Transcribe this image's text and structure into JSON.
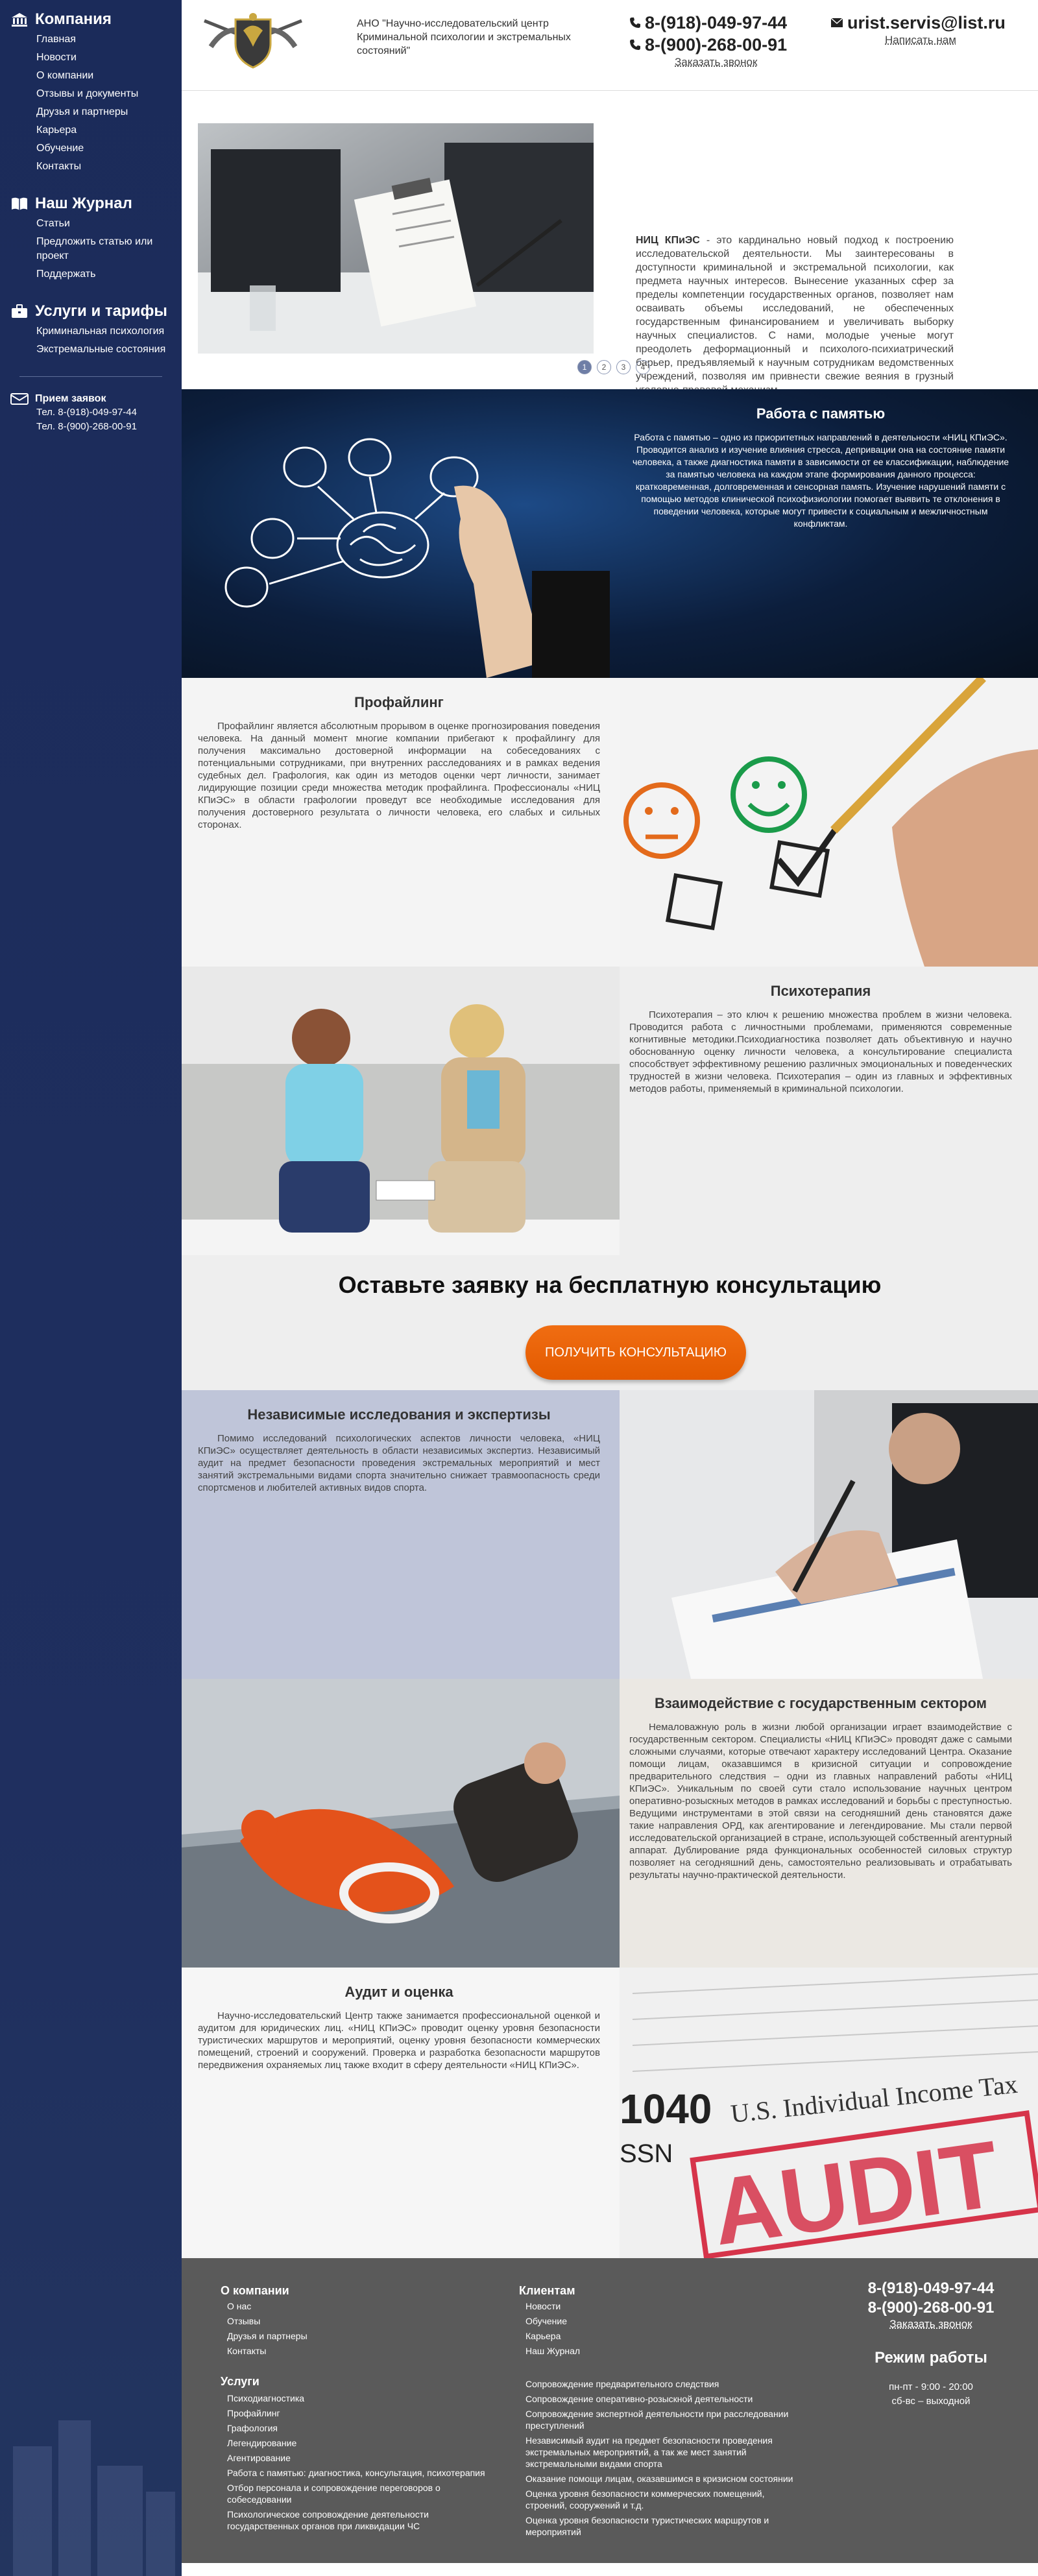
{
  "sidebar": {
    "company": {
      "title": "Компания",
      "items": [
        "Главная",
        "Новости",
        "О компании",
        "Отзывы и документы",
        "Друзья и партнеры",
        "Карьера",
        "Обучение",
        "Контакты"
      ]
    },
    "journal": {
      "title": "Наш Журнал",
      "items": [
        "Статьи",
        "Предложить статью или проект",
        "Поддержать"
      ]
    },
    "services": {
      "title": "Услуги и тарифы",
      "items": [
        "Криминальная психология",
        "Экстремальные состояния"
      ]
    },
    "contact": {
      "title": "Прием заявок",
      "phone1": "Тел. 8-(918)-049-97-44",
      "phone2": "Тел. 8-(900)-268-00-91"
    }
  },
  "header": {
    "company_name": "АНО \"Научно-исследовательский центр Криминальной психологии и экстремальных состояний\"",
    "phone1": "8-(918)-049-97-44",
    "phone2": "8-(900)-268-00-91",
    "callback_link": "Заказать звонок",
    "email": "urist.servis@list.ru",
    "write_link": "Написать нам"
  },
  "slider": {
    "lead": "НИЦ КПиЭС",
    "text": " - это кардинально новый подход к построению исследовательской деятельности. Мы заинтересованы в доступности криминальной и экстремальной психологии, как предмета научных интересов. Вынесение указанных сфер за пределы компетенции государственных органов, позволяет нам осваивать объемы исследований, не обеспеченных государственным финансированием и увеличивать выборку научных специалистов. С нами, молодые ученые могут преодолеть деформационный и психолого-психиатрический барьер, предъявляемый к научным сотрудникам ведомственных учреждений, позволяя им привнести свежие веяния в грузный уголовно-правовой механизм.",
    "dots": [
      "1",
      "2",
      "3",
      "4"
    ],
    "active_dot": 0
  },
  "memory": {
    "title": "Работа с памятью",
    "text": "Работа с памятью – одно из приоритетных направлений в деятельности «НИЦ КПиЭС». Проводится анализ и изучение влияния стресса, депривации она на состояние памяти человека, а также диагностика памяти в зависимости от ее классификации, наблюдение за памятью человека на каждом этапе формирования данного процесса: кратковременная, долговременная и сенсорная память. Изучение нарушений памяти с помощью методов клинической психофизиологии помогает выявить те отклонения в поведении человека, которые могут привести к социальным и межличностным конфликтам."
  },
  "profiling": {
    "title": "Профайлинг",
    "text": "Профайлинг является абсолютным прорывом в оценке прогнозирования поведения человека. На данный момент многие компании прибегают к профайлингу для получения максимально достоверной информации на собеседованиях с потенциальными сотрудниками, при внутренних расследованиях и в рамках ведения судебных дел. Графология, как один из методов оценки черт личности, занимает лидирующие позиции среди множества методик профайлинга. Профессионалы «НИЦ КПиЭС» в области графологии проведут все необходимые исследования для получения достоверного результата о личности человека, его слабых и сильных сторонах."
  },
  "therapy": {
    "title": "Психотерапия",
    "text": "Психотерапия – это ключ к решению множества проблем в жизни человека. Проводится работа с личностными проблемами, применяются современные когнитивные методики.Психодиагностика позволяет дать объективную и научно обоснованную оценку личности человека, а консультирование специалиста способствует эффективному решению различных эмоциональных и поведенческих трудностей в жизни человека. Психотерапия – один из главных и эффективных методов работы, применяемый в криминальной психологии."
  },
  "cta": {
    "title": "Оставьте заявку на бесплатную консультацию",
    "button": "ПОЛУЧИТЬ КОНСУЛЬТАЦИЮ"
  },
  "research": {
    "title": "Независимые исследования и экспертизы",
    "text": "Помимо исследований психологических аспектов личности человека, «НИЦ КПиЭС» осуществляет деятельность в области независимых экспертиз. Независимый аудит на предмет безопасности проведения экстремальных мероприятий и мест занятий экстремальными видами спорта значительно снижает травмоопасность среди спортсменов и любителей активных видов спорта."
  },
  "gov": {
    "title": "Взаимодействие с государственным сектором",
    "text": "Немаловажную роль в жизни любой организации играет взаимодействие с государственным сектором. Специалисты «НИЦ КПиЭС» проводят даже с самыми сложными случаями, которые отвечают характеру исследований Центра. Оказание помощи лицам, оказавшимся в кризисной ситуации и сопровождение предварительного следствия – одни из главных направлений работы «НИЦ КПиЭС». Уникальным по своей сути стало использование научных центром оперативно-розыскных методов в рамках исследований и борьбы с преступностью. Ведущими инструментами в этой связи на сегодняшний день становятся даже такие направления ОРД, как агентирование и легендирование. Мы стали первой исследовательской организацией в стране, использующей собственный агентурный аппарат. Дублирование ряда функциональных особенностей силовых структур позволяет на сегодняшний день, самостоятельно реализовывать и отрабатывать результаты научно-практической деятельности."
  },
  "audit": {
    "title": "Аудит и оценка",
    "text": "Научно-исследовательский Центр также занимается профессиональной оценкой и аудитом для юридических лиц. «НИЦ КПиЭС» проводит оценку уровня безопасности туристических маршрутов и мероприятий, оценку уровня безопасности коммерческих помещений, строений и сооружений. Проверка и разработка безопасности маршрутов передвижения охраняемых лиц также входит в сферу деятельности «НИЦ КПиЭС».",
    "image_words": [
      "1040",
      "U.S. Individual Income Tax",
      "AUDIT",
      "SSN"
    ]
  },
  "footer": {
    "about": {
      "title": "О компании",
      "items": [
        "О нас",
        "Отзывы",
        "Друзья и партнеры",
        "Контакты"
      ]
    },
    "clients": {
      "title": "Клиентам",
      "items": [
        "Новости",
        "Обучение",
        "Карьера",
        "Наш Журнал"
      ]
    },
    "services": {
      "title": "Услуги",
      "items": [
        "Психодиагностика",
        "Профайлинг",
        "Графология",
        "Легендирование",
        "Агентирование",
        "Работа с памятью: диагностика, консультация, психотерапия",
        "Отбор персонала и сопровождение переговоров о собеседовании",
        "Психологическое сопровождение деятельности государственных органов при ликвидации ЧС"
      ],
      "items2": [
        "Сопровождение предварительного следствия",
        "Сопровождение оперативно-розыскной деятельности",
        "Сопровождение экспертной деятельности при расследовании преступлений",
        "Независимый аудит на предмет безопасности проведения экстремальных мероприятий, а так же мест занятий экстремальными видами спорта",
        "Оказание помощи лицам, оказавшимся в кризисном состоянии",
        "Оценка уровня безопасности коммерческих помещений, строений, сооружений и т.д.",
        "Оценка уровня безопасности туристических маршрутов и мероприятий"
      ]
    },
    "phone1": "8-(918)-049-97-44",
    "phone2": "8-(900)-268-00-91",
    "callback": "Заказать звонок",
    "mode_title": "Режим работы",
    "mode1": "пн-пт - 9:00 - 20:00",
    "mode2": "сб-вс – выходной"
  }
}
